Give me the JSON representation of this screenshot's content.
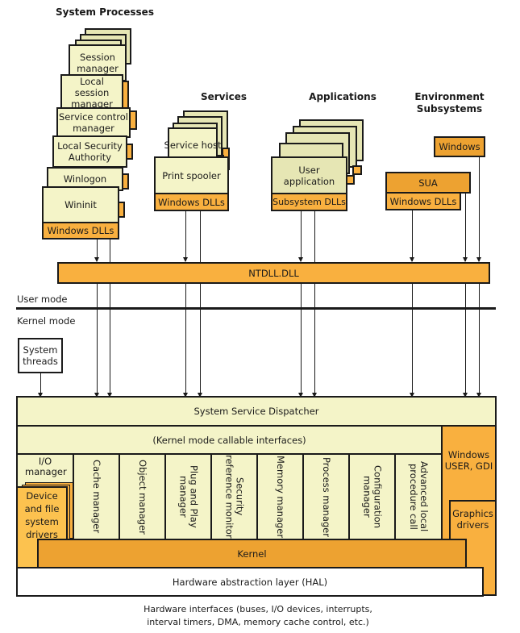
{
  "headers": {
    "system_processes": "System Processes",
    "services": "Services",
    "applications": "Applications",
    "environment_subsystems": "Environment Subsystems"
  },
  "system_processes": {
    "items": [
      "Session manager",
      "Local session manager",
      "Service control manager",
      "Local Security Authority",
      "Winlogon",
      "Wininit"
    ],
    "dlls": "Windows DLLs"
  },
  "services": {
    "items": [
      "Service host",
      "Print spooler"
    ],
    "dlls": "Windows DLLs"
  },
  "applications": {
    "item": "User application",
    "dlls": "Subsystem DLLs"
  },
  "environment_subsystems": {
    "windows": "Windows",
    "sua": "SUA",
    "dlls": "Windows DLLs"
  },
  "ntdll": "NTDLL.DLL",
  "modes": {
    "user": "User mode",
    "kernel": "Kernel mode"
  },
  "system_threads": "System threads",
  "kernel_layer": {
    "dispatcher": "System Service Dispatcher",
    "callable": "(Kernel mode callable interfaces)",
    "io_manager": "I/O manager",
    "device_drivers": "Device and file system drivers",
    "components": [
      "Cache manager",
      "Object manager",
      "Plug and Play manager",
      "Security reference monitor",
      "Memory manager",
      "Process manager",
      "Configuration manager",
      "Advanced local procedure call"
    ],
    "windows_user_gdi": "Windows USER, GDI",
    "graphics_drivers": "Graphics drivers",
    "kernel": "Kernel",
    "hal": "Hardware abstraction layer (HAL)"
  },
  "footer": "Hardware interfaces (buses, I/O devices, interrupts, interval timers, DMA, memory cache control, etc.)"
}
